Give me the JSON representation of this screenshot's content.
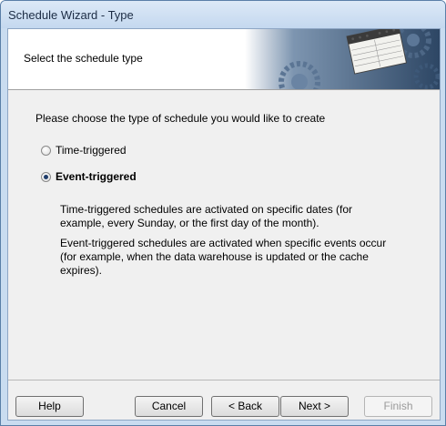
{
  "window": {
    "title": "Schedule Wizard - Type"
  },
  "header": {
    "title": "Select the schedule type",
    "art_icon": "calendar-gears-banner"
  },
  "main": {
    "prompt": "Please choose the type of schedule you would like to create",
    "options": [
      {
        "label": "Time-triggered",
        "selected": false
      },
      {
        "label": "Event-triggered",
        "selected": true
      }
    ],
    "descriptions": [
      "Time-triggered schedules are activated on specific dates (for example, every Sunday, or the first day of the month).",
      "Event-triggered schedules are activated when specific events occur (for example, when the data warehouse is  updated or the cache expires)."
    ]
  },
  "footer": {
    "help_label": "Help",
    "cancel_label": "Cancel",
    "back_label": "< Back",
    "next_label": "Next >",
    "finish_label": "Finish",
    "finish_enabled": false
  },
  "colors": {
    "titlebar": "#c4d8ef",
    "frame": "#c9dcf0",
    "client": "#f0f0f0",
    "banner_art": "#3f5e80"
  }
}
